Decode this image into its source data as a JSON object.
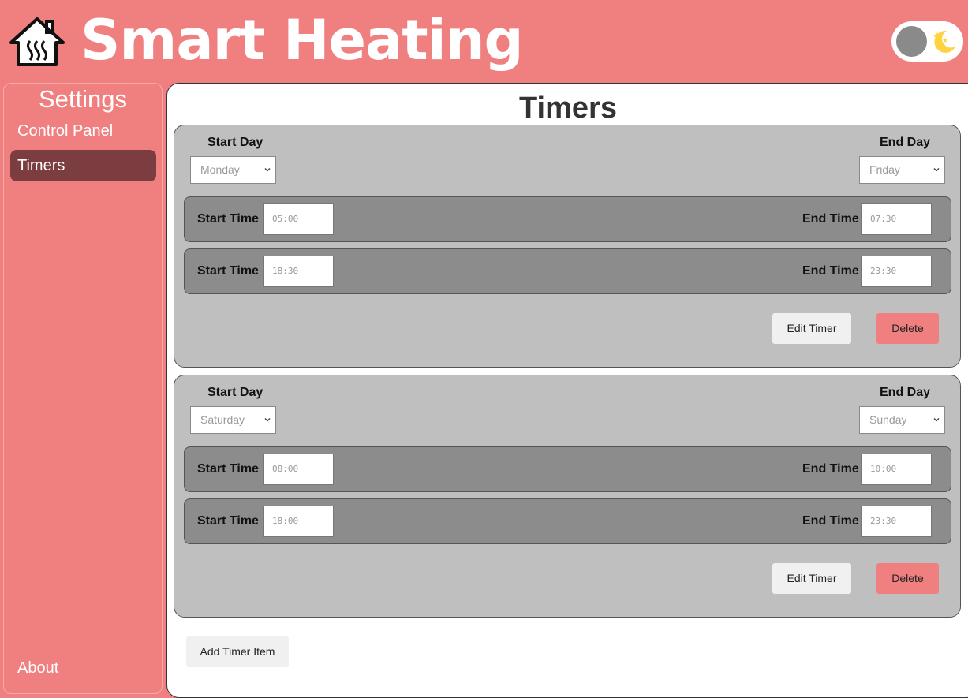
{
  "header": {
    "app_title": "Smart Heating",
    "logo_icon": "heating-house-icon",
    "theme_toggle_icon": "moon-stars-icon"
  },
  "sidebar": {
    "heading": "Settings",
    "items": [
      {
        "label": "Control Panel",
        "active": false
      },
      {
        "label": "Timers",
        "active": true
      }
    ],
    "footer_item": "About"
  },
  "main": {
    "title": "Timers",
    "timers": [
      {
        "start_day_label": "Start Day",
        "start_day": "Monday",
        "end_day_label": "End Day",
        "end_day": "Friday",
        "periods": [
          {
            "start_label": "Start Time",
            "start": "05:00",
            "end_label": "End Time",
            "end": "07:30"
          },
          {
            "start_label": "Start Time",
            "start": "18:30",
            "end_label": "End Time",
            "end": "23:30"
          }
        ],
        "edit_label": "Edit Timer",
        "delete_label": "Delete"
      },
      {
        "start_day_label": "Start Day",
        "start_day": "Saturday",
        "end_day_label": "End Day",
        "end_day": "Sunday",
        "periods": [
          {
            "start_label": "Start Time",
            "start": "08:00",
            "end_label": "End Time",
            "end": "10:00"
          },
          {
            "start_label": "Start Time",
            "start": "18:00",
            "end_label": "End Time",
            "end": "23:30"
          }
        ],
        "edit_label": "Edit Timer",
        "delete_label": "Delete"
      }
    ],
    "add_label": "Add Timer Item"
  },
  "colors": {
    "brand": "#f08080",
    "active_nav": "#7b3d3f",
    "card_bg": "#bfbfbf",
    "row_bg": "#8c8c8c"
  }
}
